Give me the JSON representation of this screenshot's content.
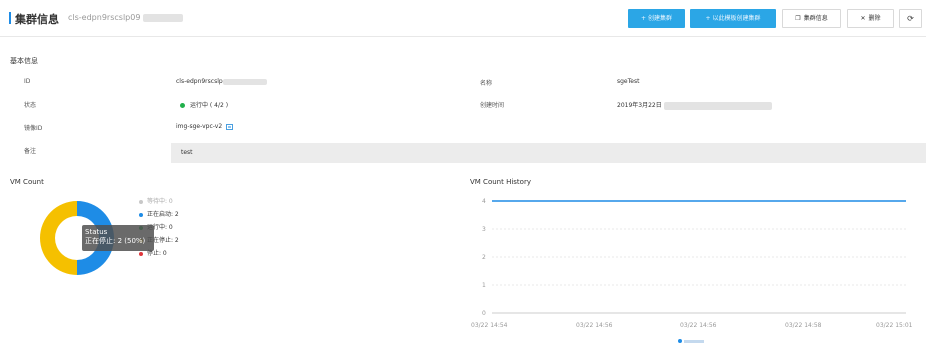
{
  "header": {
    "title": "集群信息",
    "cluster_id": "cls-edpn9rscslp09",
    "buttons": {
      "create_cluster": "+ 创建集群",
      "create_from_template": "+ 以此模板创建集群",
      "cluster_info": "集群信息",
      "delete": "删除",
      "refresh_icon": "refresh-icon"
    }
  },
  "basic_info": {
    "section_title": "基本信息",
    "id_label": "ID",
    "id_value": "cls-edpn9rscslp",
    "name_label": "名称",
    "name_value": "sgeTest",
    "status_label": "状态",
    "status_value": "运行中 ( 4/2 )",
    "created_label": "创建时间",
    "created_value": "2019年3月22日",
    "image_label": "镜像ID",
    "image_value": "img-sge-vpc-v2",
    "remark_label": "备注",
    "remark_value": "test"
  },
  "colors": {
    "accent": "#2ba6e6",
    "running": "#21b04b",
    "starting": "#1e8ce6",
    "stopping": "#f5c000",
    "stopped": "#e0363c",
    "waiting": "#c8c8c8"
  },
  "vm_count": {
    "title": "VM Count",
    "legend": [
      {
        "label": "等待中: 0",
        "color": "#c8c8c8"
      },
      {
        "label": "正在启动: 2",
        "color": "#1e8ce6"
      },
      {
        "label": "运行中: 0",
        "color": "#21b04b"
      },
      {
        "label": "正在停止: 2",
        "color": "#f5c000"
      },
      {
        "label": "停止: 0",
        "color": "#e0363c"
      }
    ],
    "tooltip_title": "Status",
    "tooltip_value": "正在停止: 2 (50%)"
  },
  "chart_data": [
    {
      "type": "pie",
      "title": "VM Count",
      "categories": [
        "等待中",
        "正在启动",
        "运行中",
        "正在停止",
        "停止"
      ],
      "values": [
        0,
        2,
        0,
        2,
        0
      ],
      "colors": [
        "#c8c8c8",
        "#1e8ce6",
        "#21b04b",
        "#f5c000",
        "#e0363c"
      ],
      "donut": true,
      "legend": "right"
    },
    {
      "type": "line",
      "title": "VM Count History",
      "x": [
        "03/22 14:54",
        "03/22 14:56",
        "03/22 14:56",
        "03/22 14:58",
        "03/22 15:01"
      ],
      "series": [
        {
          "values": [
            4,
            4,
            4,
            4,
            4
          ],
          "color": "#1e8ce6"
        }
      ],
      "yticks": [
        "0",
        "1",
        "2",
        "3",
        "4"
      ],
      "ylim": [
        0,
        4
      ],
      "grid": true,
      "legend": "bottom"
    }
  ]
}
